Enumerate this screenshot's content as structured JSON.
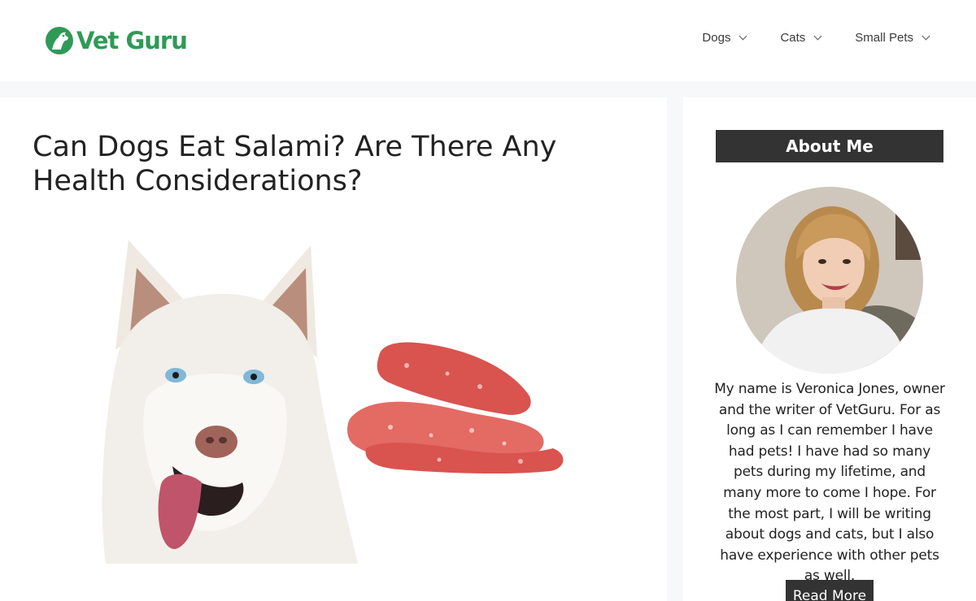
{
  "header": {
    "logo_text": "Vet Guru",
    "brand_color": "#2f9a57",
    "nav": [
      {
        "label": "Dogs",
        "icon": "chevron-down-icon"
      },
      {
        "label": "Cats",
        "icon": "chevron-down-icon"
      },
      {
        "label": "Small Pets",
        "icon": "chevron-down-icon"
      }
    ]
  },
  "article": {
    "title": "Can Dogs Eat Salami? Are There Any Health Considerations?",
    "featured_image": "husky-and-salami-image"
  },
  "sidebar": {
    "widget_title": "About Me",
    "avatar": "author-photo",
    "about_text": "My name is Veronica Jones, owner and the writer of VetGuru. For as long as I can remember I have had pets! I have had so many pets during my lifetime, and many more to come I hope. For the most part, I will be writing about dogs and cats, but I also have experience with other pets as well.",
    "read_more_label": "Read More"
  },
  "colors": {
    "page_background": "#f7f8f9",
    "dark_button": "#333333"
  }
}
